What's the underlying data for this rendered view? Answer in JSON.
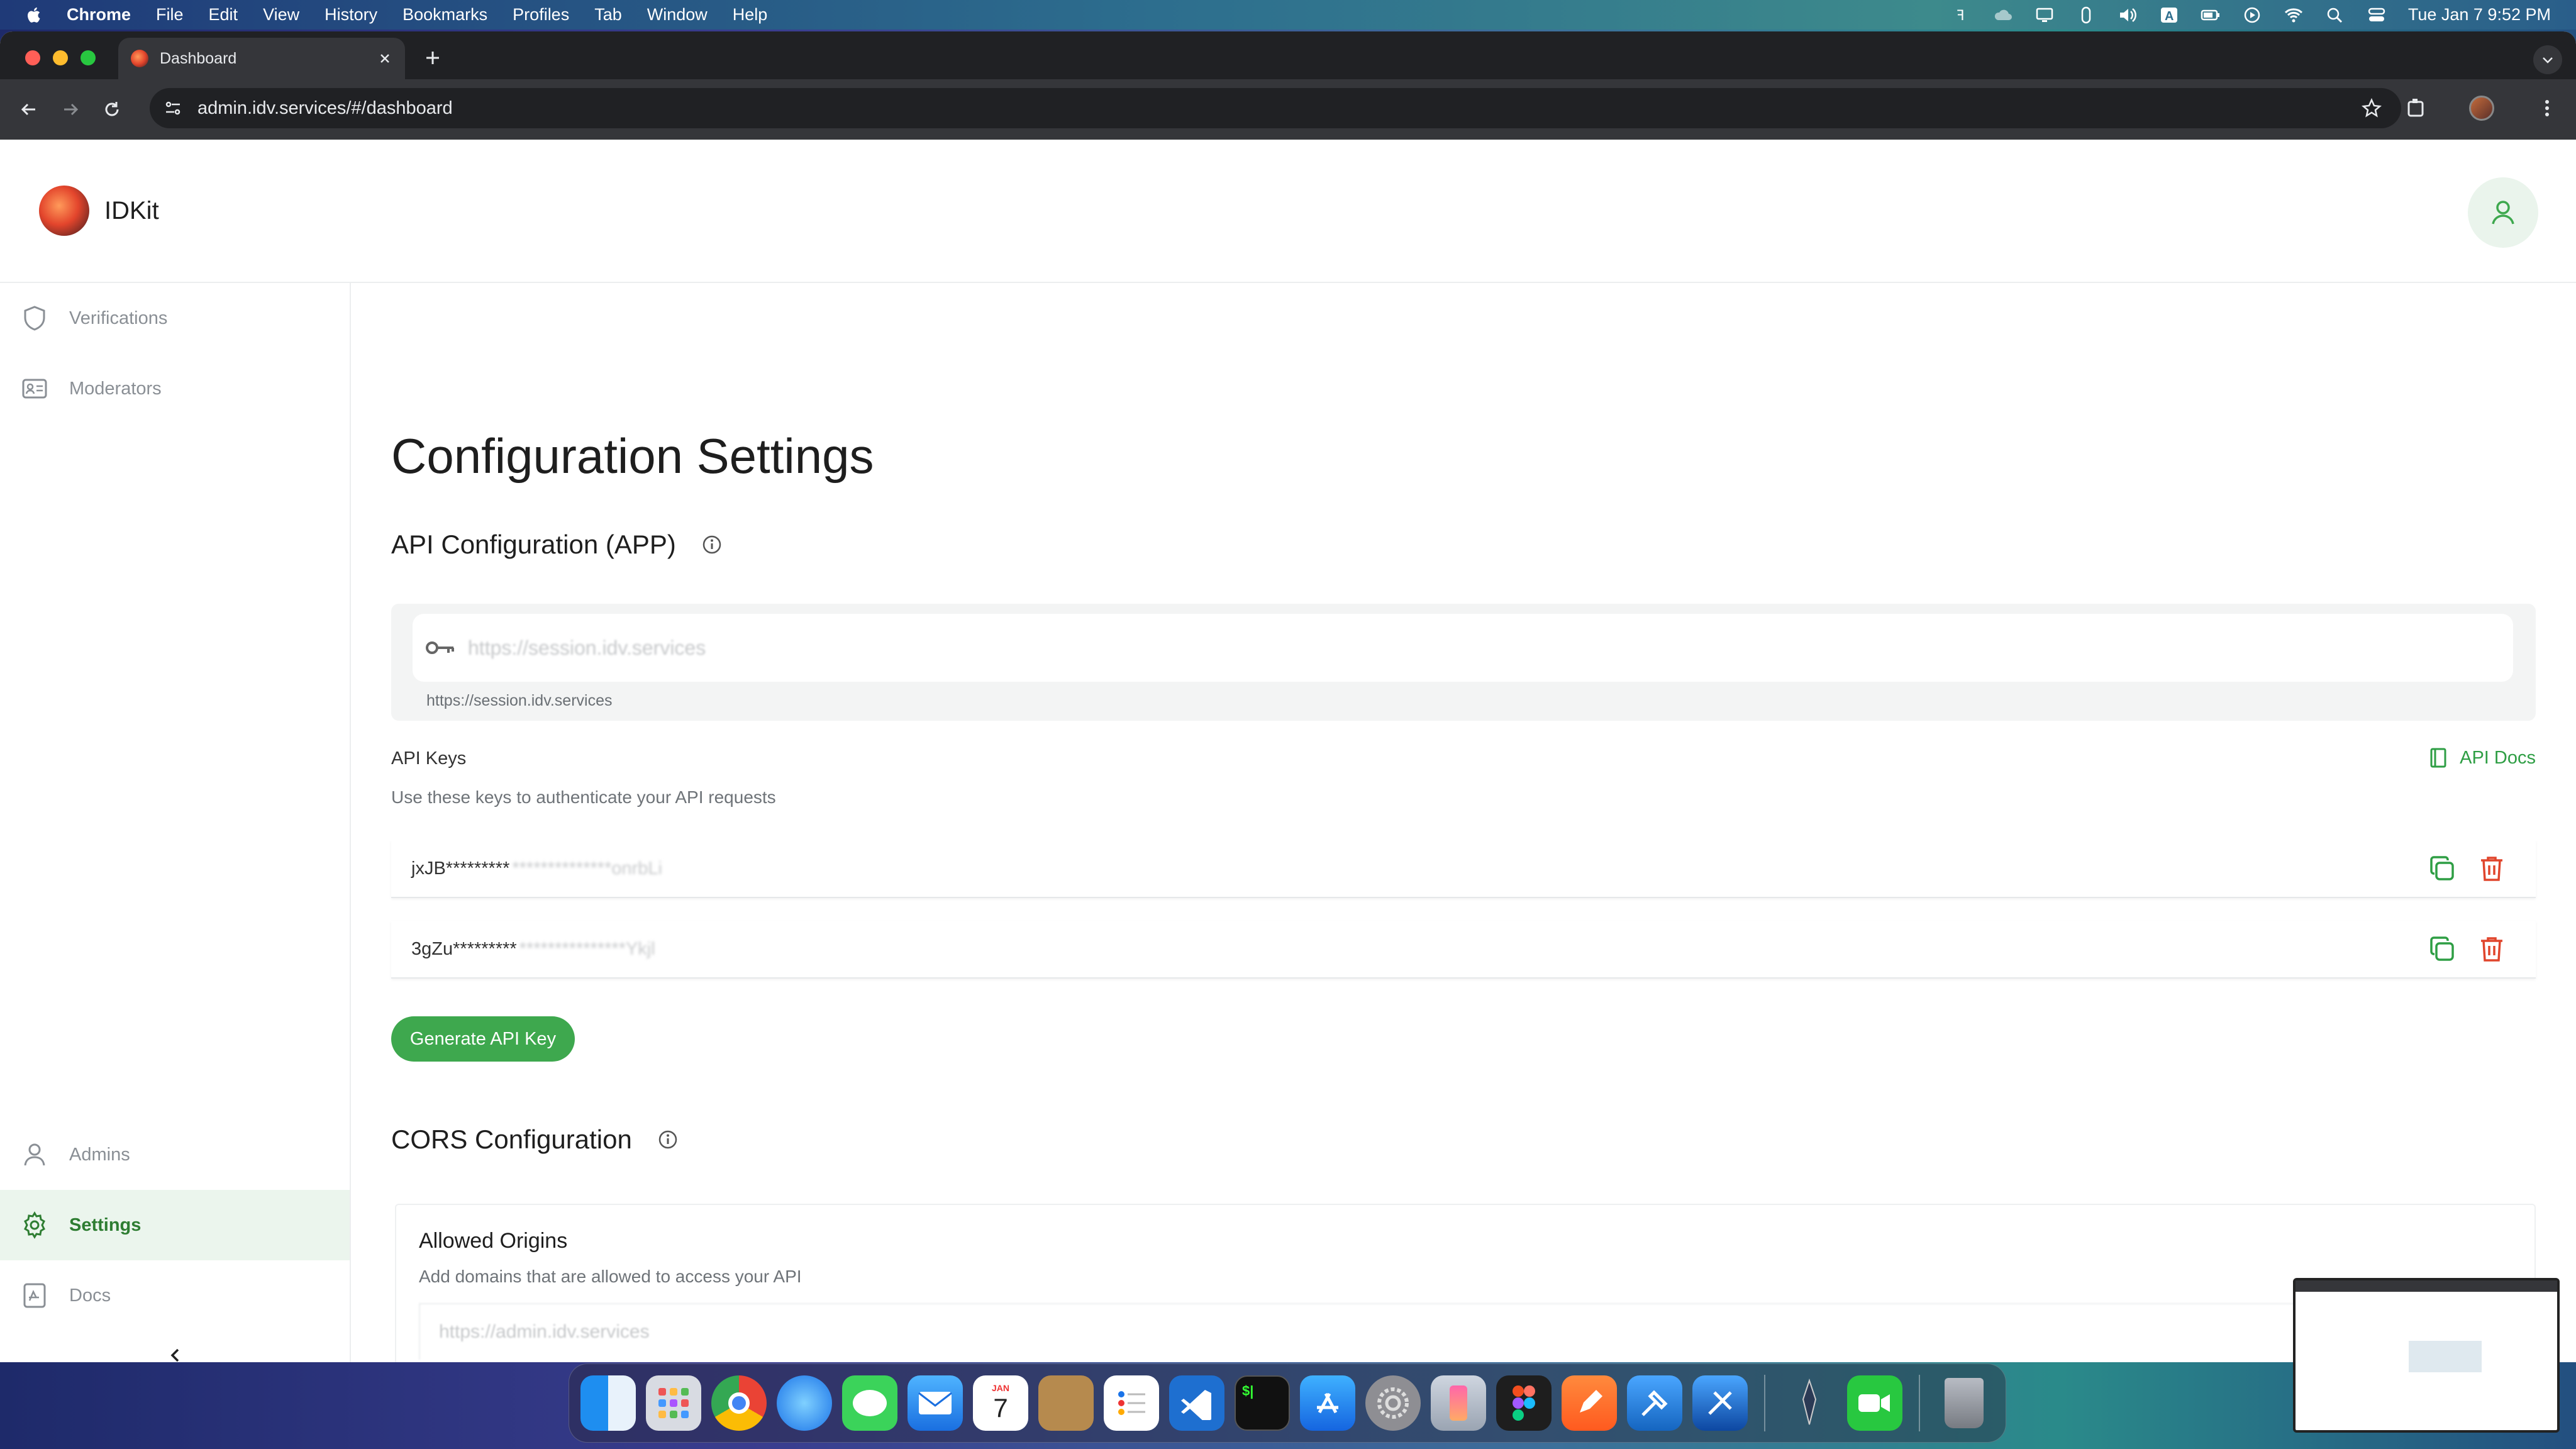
{
  "menubar": {
    "app": "Chrome",
    "items": [
      "File",
      "Edit",
      "View",
      "History",
      "Bookmarks",
      "Profiles",
      "Tab",
      "Window",
      "Help"
    ],
    "clock": "Tue Jan 7  9:52 PM"
  },
  "browser": {
    "tab_title": "Dashboard",
    "url": "admin.idv.services/#/dashboard"
  },
  "app": {
    "brand": "IDKit"
  },
  "sidebar": {
    "items": [
      {
        "label": "Verifications",
        "icon": "shield-icon"
      },
      {
        "label": "Moderators",
        "icon": "id-card-icon"
      },
      {
        "label": "Admins",
        "icon": "person-icon"
      },
      {
        "label": "Settings",
        "icon": "gear-icon",
        "active": true
      },
      {
        "label": "Docs",
        "icon": "docs-icon"
      }
    ]
  },
  "main": {
    "page_title": "Configuration Settings",
    "api_section": {
      "title": "API Configuration (APP)",
      "url_placeholder": "https://session.idv.services",
      "url_helper": "https://session.idv.services",
      "keys_label": "API Keys",
      "keys_description": "Use these keys to authenticate your API requests",
      "docs_link": "API Docs",
      "keys": [
        {
          "masked": "jxJB*********",
          "hidden": "**************onrbLi"
        },
        {
          "masked": "3gZu*********",
          "hidden": "***************Ykjl"
        }
      ],
      "generate_button": "Generate API Key"
    },
    "cors_section": {
      "title": "CORS Configuration",
      "origins_title": "Allowed Origins",
      "origins_description": "Add domains that are allowed to access your API",
      "origin_value": "https://admin.idv.services"
    }
  },
  "dock": {
    "calendar_month": "JAN",
    "calendar_day": "7"
  },
  "colors": {
    "accent_green": "#3ea84e",
    "active_nav_bg": "#ebf5ed",
    "delete_red": "#e0452c",
    "chrome_dark": "#35363a"
  }
}
